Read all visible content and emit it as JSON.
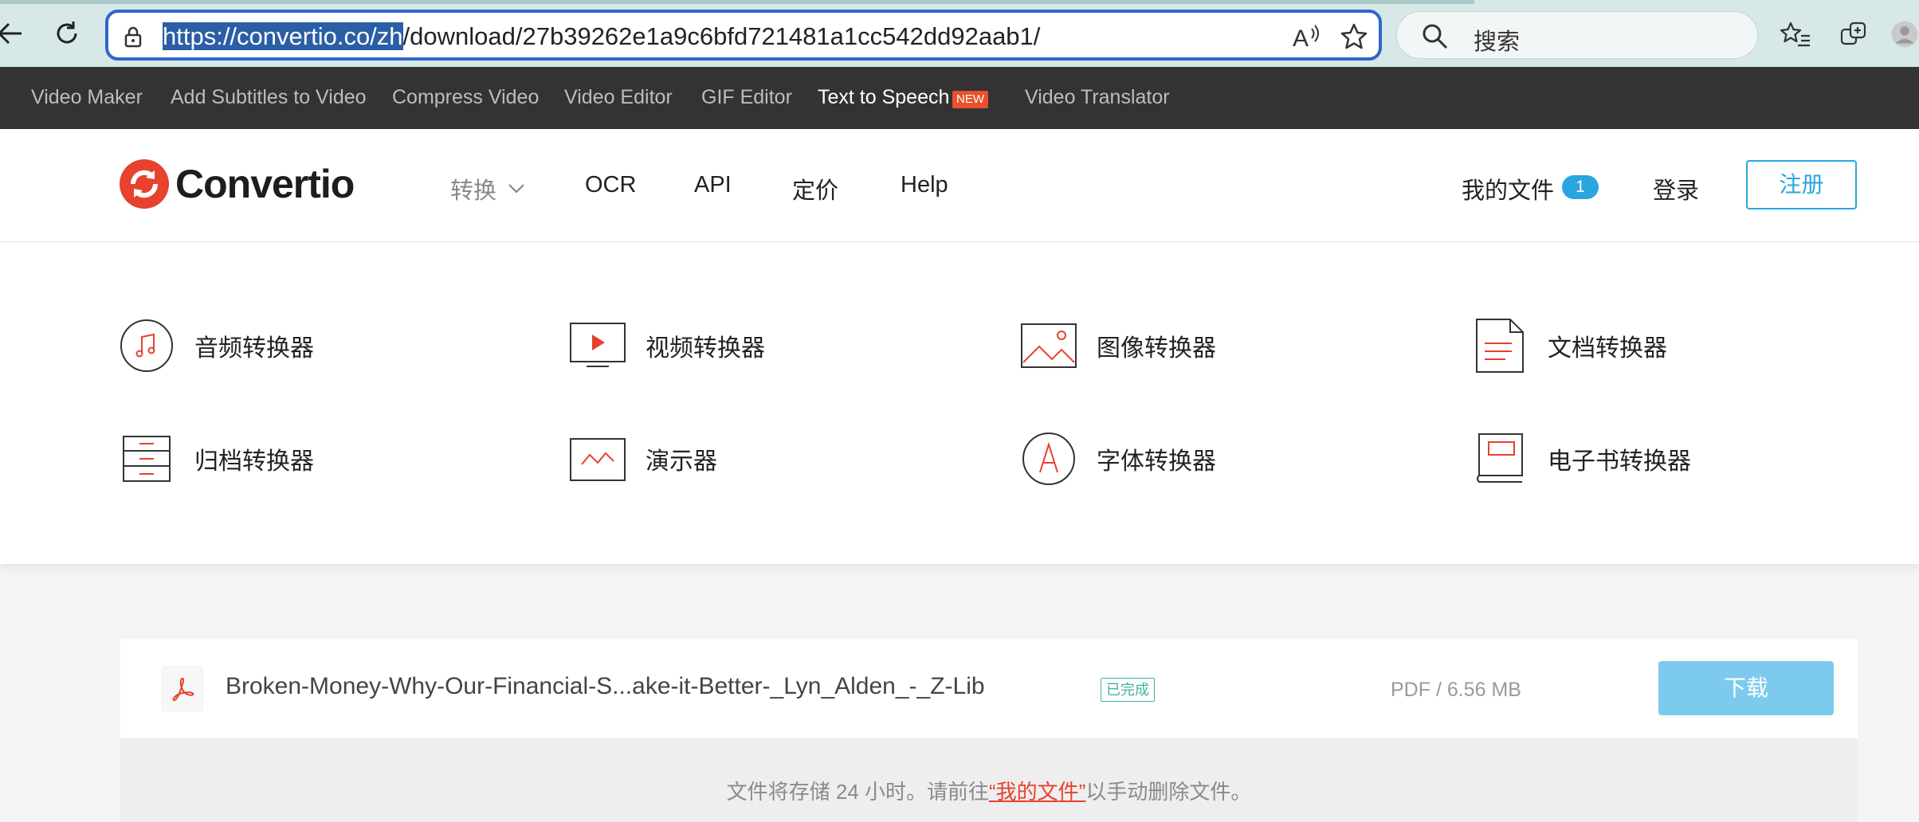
{
  "browser": {
    "url_selected": "https://convertio.co/zh",
    "url_rest": "/download/27b39262e1a9c6bfd721481a1cc542dd92aab1/",
    "search_placeholder": "搜索"
  },
  "promo_bar": {
    "items": [
      "Video Maker",
      "Add Subtitles to Video",
      "Compress Video",
      "Video Editor",
      "GIF Editor",
      "Text to Speech",
      "Video Translator"
    ],
    "new_badge": "NEW"
  },
  "header": {
    "logo_text": "Convertio",
    "menu": [
      "转换",
      "OCR",
      "API",
      "定价",
      "Help"
    ],
    "my_files_label": "我的文件",
    "my_files_count": "1",
    "login_label": "登录",
    "signup_label": "注册"
  },
  "categories": [
    {
      "label": "音频转换器",
      "icon": "audio-icon"
    },
    {
      "label": "视频转换器",
      "icon": "video-icon"
    },
    {
      "label": "图像转换器",
      "icon": "image-icon"
    },
    {
      "label": "文档转换器",
      "icon": "document-icon"
    },
    {
      "label": "归档转换器",
      "icon": "archive-icon"
    },
    {
      "label": "演示器",
      "icon": "presentation-icon"
    },
    {
      "label": "字体转换器",
      "icon": "font-icon"
    },
    {
      "label": "电子书转换器",
      "icon": "ebook-icon"
    }
  ],
  "file": {
    "name": "Broken-Money-Why-Our-Financial-S...ake-it-Better-_Lyn_Alden_-_Z-Lib",
    "status": "已完成",
    "meta": "PDF / 6.56 MB",
    "download_label": "下载"
  },
  "storage_note": {
    "before": "文件将存储 24 小时。请前往",
    "link": "“我的文件”",
    "after": "以手动删除文件。"
  },
  "colors": {
    "accent_blue": "#29a6df",
    "brand_red": "#e8412d",
    "promo_bg": "#333333"
  }
}
